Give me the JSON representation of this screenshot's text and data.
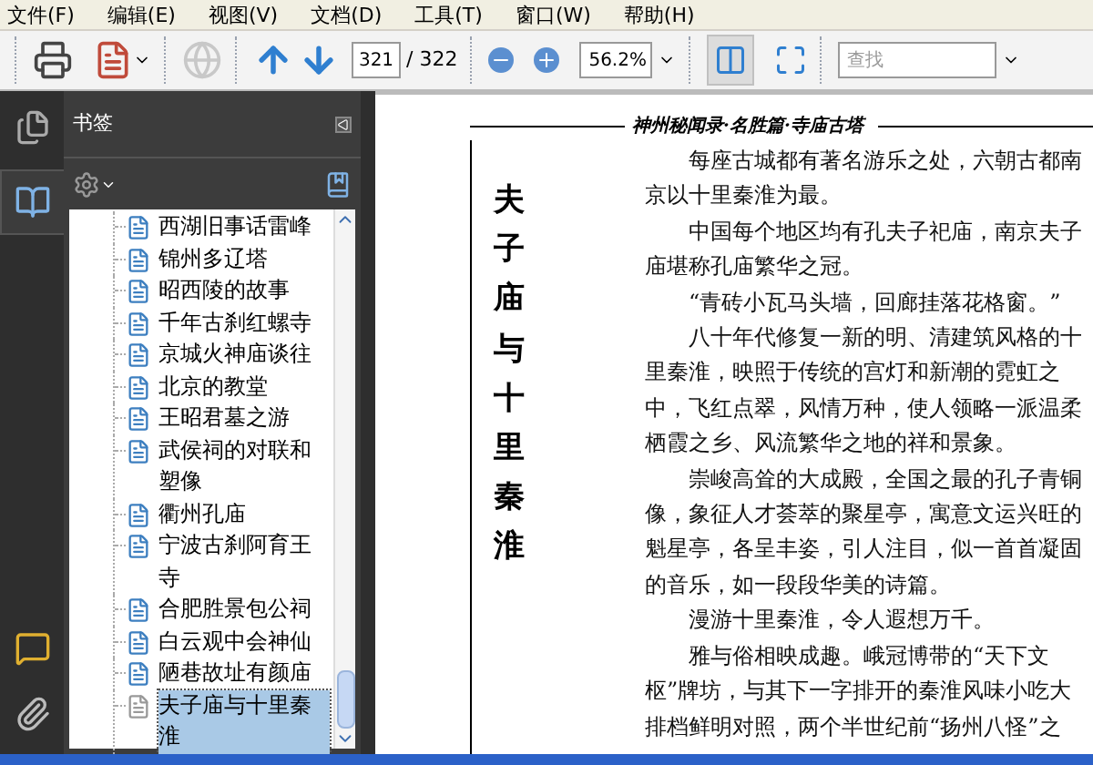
{
  "menu": [
    "文件(F)",
    "编辑(E)",
    "视图(V)",
    "文档(D)",
    "工具(T)",
    "窗口(W)",
    "帮助(H)"
  ],
  "toolbar": {
    "page_number": "321",
    "page_total": "/ 322",
    "zoom": "56.2%",
    "search": {
      "placeholder": "查找"
    },
    "fit_width_selected": true
  },
  "sidebar": {
    "title": "书签",
    "bookmarks_tab_selected": true,
    "bookmarks": [
      {
        "label": "西湖旧事话雷峰",
        "selected": false
      },
      {
        "label": "锦州多辽塔",
        "selected": false
      },
      {
        "label": "昭西陵的故事",
        "selected": false
      },
      {
        "label": "千年古刹红螺寺",
        "selected": false
      },
      {
        "label": "京城火神庙谈往",
        "selected": false
      },
      {
        "label": "北京的教堂",
        "selected": false
      },
      {
        "label": "王昭君墓之游",
        "selected": false
      },
      {
        "label": "武侯祠的对联和塑像",
        "selected": false
      },
      {
        "label": "衢州孔庙",
        "selected": false
      },
      {
        "label": "宁波古刹阿育王寺",
        "selected": false
      },
      {
        "label": "合肥胜景包公祠",
        "selected": false
      },
      {
        "label": "白云观中会神仙",
        "selected": false
      },
      {
        "label": "陋巷故址有颜庙",
        "selected": false
      },
      {
        "label": "夫子庙与十里秦淮",
        "selected": true
      }
    ]
  },
  "document": {
    "running_header": "神州秘闻录·名胜篇·寺庙古塔",
    "chapter_title": "夫子庙与十里秦淮",
    "paragraphs": [
      "每座古城都有著名游乐之处，六朝古都南京以十里秦淮为最。",
      "中国每个地区均有孔夫子祀庙，南京夫子庙堪称孔庙繁华之冠。",
      "“青砖小瓦马头墙，回廊挂落花格窗。”",
      "八十年代修复一新的明、清建筑风格的十里秦淮，映照于传统的宫灯和新潮的霓虹之中，飞红点翠，风情万种，使人领略一派温柔栖霞之乡、风流繁华之地的祥和景象。",
      "崇峻高耸的大成殿，全国之最的孔子青铜像，象征人才荟萃的聚星亭，寓意文运兴旺的魁星亭，各呈丰姿，引人注目，似一首首凝固的音乐，如一段段华美的诗篇。",
      "漫游十里秦淮，令人遐想万千。",
      "雅与俗相映成趣。峨冠博带的“天下文枢”牌坊，与其下一字排开的秦淮风味小吃大排档鲜明对照，两个半世纪前“扬州八怪”之"
    ]
  }
}
